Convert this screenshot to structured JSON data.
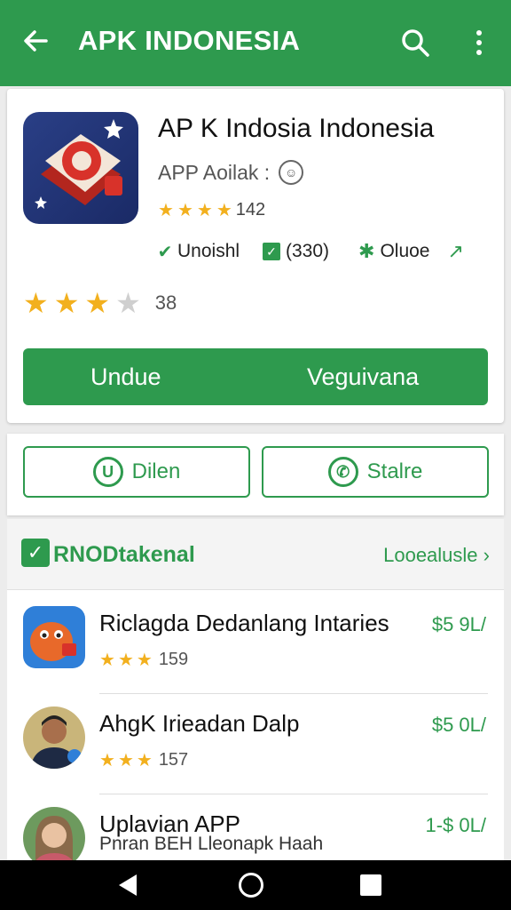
{
  "appbar": {
    "title": "APK INDONESIA",
    "back_icon": "arrow-left-icon",
    "search_icon": "search-icon",
    "more_icon": "more-vert-icon"
  },
  "app": {
    "name": "AP K Indosia Indonesia",
    "subtitle": "APP Aoilak :",
    "rating_count": "142",
    "meta": {
      "item1": "Unoishl",
      "item2": "(330)",
      "item3": "Oluoe"
    },
    "big_rating_count": "38",
    "big_rating_stars": 3
  },
  "cta": {
    "left": "Undue",
    "right": "Veguivana"
  },
  "buttons": {
    "b1": "Dilen",
    "b2": "Stalre"
  },
  "section": {
    "title": "RNODtakenal",
    "more": "Looealusle"
  },
  "list": [
    {
      "name": "Riclagda Dedanlang Intaries",
      "price": "$5 9L/",
      "rating": "159",
      "stars": 3
    },
    {
      "name": "AhgK Irieadan Dalp",
      "price": "$5 0L/",
      "rating": "157",
      "stars": 3
    },
    {
      "name": "Uplavian APP",
      "price": "1-$ 0L/",
      "sub": "Pnran BEH Lleonapk Haah"
    }
  ],
  "colors": {
    "accent": "#2e9a4e",
    "star": "#f2b01e"
  }
}
